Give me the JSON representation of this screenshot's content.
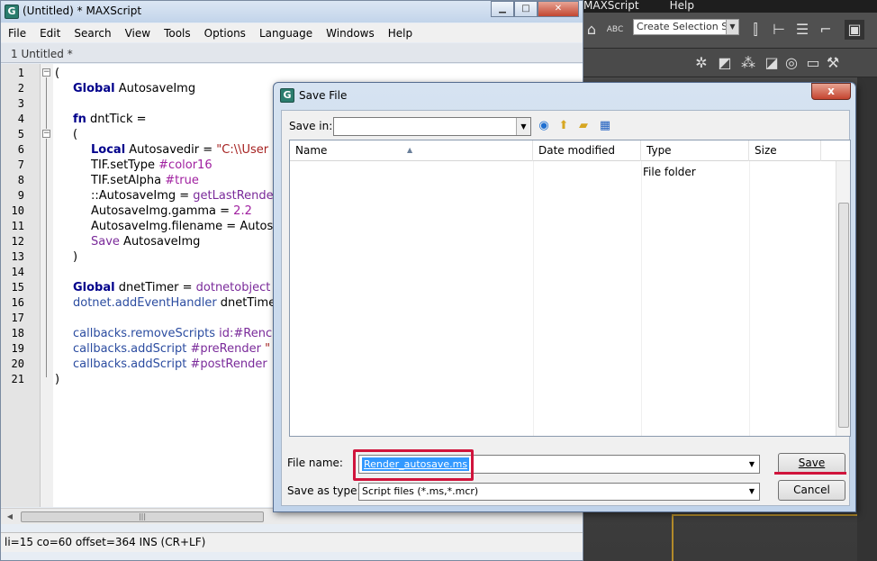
{
  "max": {
    "menu": [
      "MAXScript",
      "Help"
    ],
    "selection_set": "Create Selection Se",
    "toolbar_label": "ABC"
  },
  "editor": {
    "title": "(Untitled) * MAXScript",
    "logo": "G",
    "menu": [
      "File",
      "Edit",
      "Search",
      "View",
      "Tools",
      "Options",
      "Language",
      "Windows",
      "Help"
    ],
    "tab": "1 Untitled *",
    "line_numbers": [
      "1",
      "2",
      "3",
      "4",
      "5",
      "6",
      "7",
      "8",
      "9",
      "10",
      "11",
      "12",
      "13",
      "14",
      "15",
      "16",
      "17",
      "18",
      "19",
      "20",
      "21"
    ],
    "code": {
      "l1": "(",
      "l2_kw": "Global",
      "l2_rest": " AutosaveImg",
      "l4_kw": "fn",
      "l4_rest": " dntTick =",
      "l5": "(",
      "l6_kw": "Local",
      "l6_name": " Autosavedir = ",
      "l6_str": "\"C:\\\\User",
      "l7_a": "TIF.setType ",
      "l7_b": "#color16",
      "l8_a": "TIF.setAlpha ",
      "l8_b": "#true",
      "l9_a": "::AutosaveImg = ",
      "l9_b": "getLastRende",
      "l10_a": "AutosaveImg.gamma = ",
      "l10_b": "2.2",
      "l11": "AutosaveImg.filename = Autos",
      "l12_a": "Save",
      "l12_b": " AutosaveImg",
      "l13": ")",
      "l15_kw": "Global",
      "l15_name": " dnetTimer = ",
      "l15_fn": "dotnetobject",
      "l16_a": "dotnet.addEventHandler",
      "l16_b": " dnetTime",
      "l18_a": "callbacks.removeScripts",
      "l18_b": " id:#Renc",
      "l19_a": "callbacks.addScript",
      "l19_b": " #preRender ",
      "l19_c": "\"",
      "l20_a": "callbacks.addScript",
      "l20_b": " #postRender",
      "l21": ")"
    },
    "hscroll_grip": "|||",
    "status": "li=15 co=60 offset=364 INS (CR+LF)"
  },
  "dialog": {
    "title": "Save File",
    "logo": "G",
    "close": "x",
    "save_in_label": "Save in:",
    "save_in_value": "",
    "columns": [
      "Name",
      "Date modified",
      "Type",
      "Size"
    ],
    "rows": [
      {
        "name": "",
        "date": "",
        "type": "File folder",
        "size": ""
      }
    ],
    "file_name_label": "File name:",
    "file_name_value": "Render_autosave.ms",
    "save_as_type_label": "Save as type:",
    "save_as_type_value": "Script files (*.ms,*.mcr)",
    "save_button": "Save",
    "cancel_button": "Cancel",
    "highlight_color": "#d0143c"
  }
}
